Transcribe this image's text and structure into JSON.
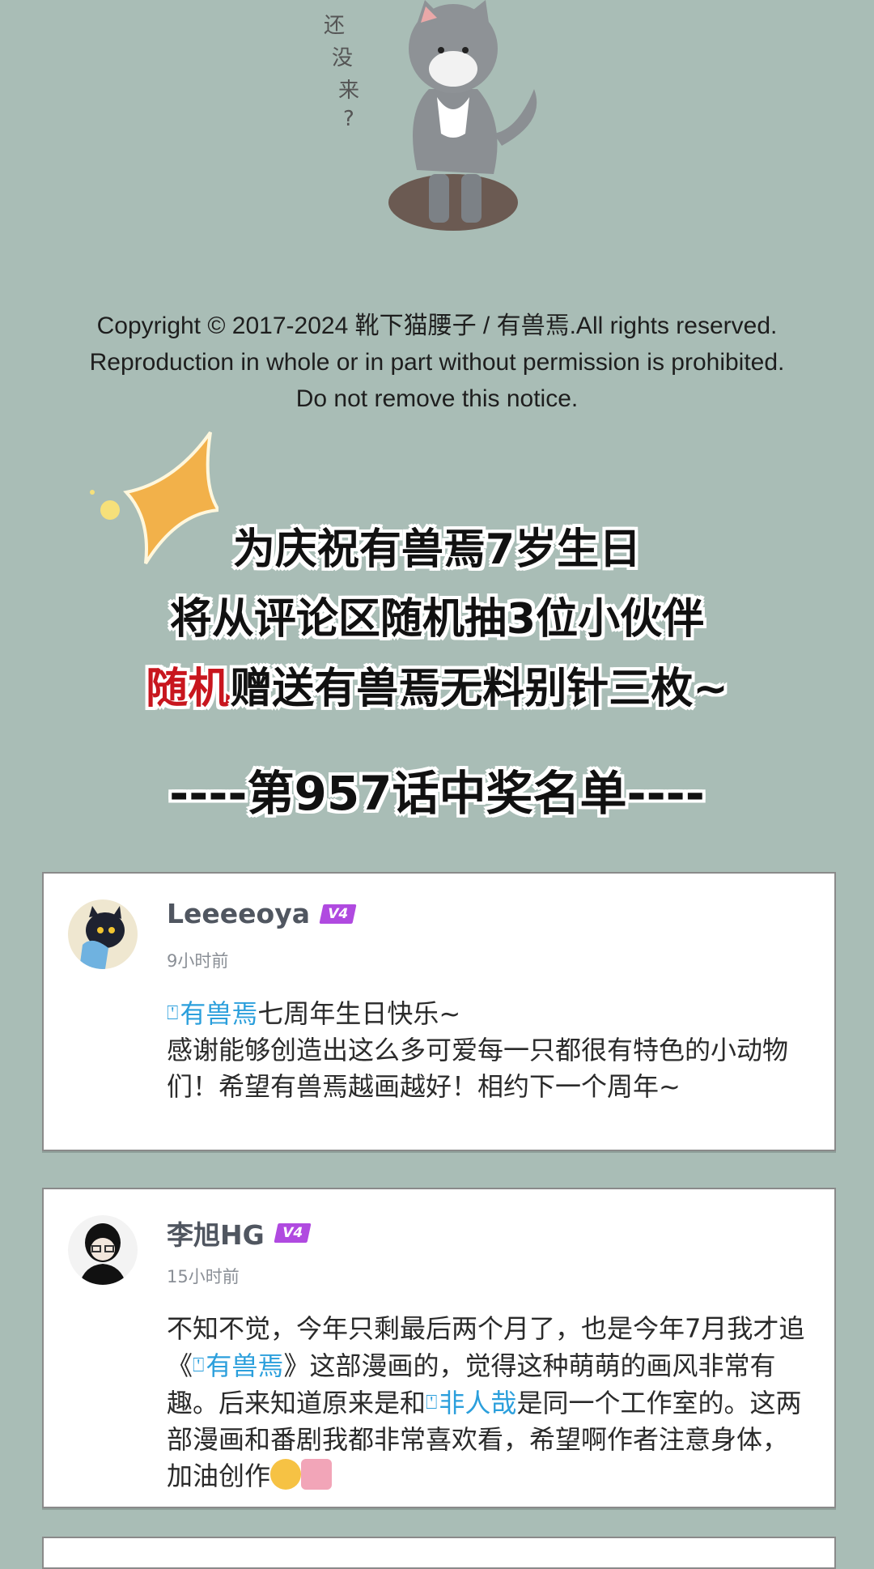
{
  "illustration": {
    "handwriting": [
      "还",
      "没",
      "来",
      "?"
    ]
  },
  "copyright": {
    "line1": "Copyright © 2017-2024 靴下猫腰子 / 有兽焉.All rights reserved.",
    "line2": "Reproduction in whole or in part without permission is prohibited.",
    "line3": "Do not remove this notice."
  },
  "banner": {
    "line1": "为庆祝有兽焉7岁生日",
    "line2": "将从评论区随机抽3位小伙伴",
    "line3_highlight": "随机",
    "line3_rest": "赠送有兽焉无料别针三枚~"
  },
  "winners_title": "----第957话中奖名单----",
  "comments": [
    {
      "username": "Leeeeoya",
      "badge": "V4",
      "time": "9小时前",
      "link_text": "有兽焉",
      "text_after_link": "七周年生日快乐~",
      "text_rest": "感谢能够创造出这么多可爱每一只都很有特色的小动物们！希望有兽焉越画越好！相约下一个周年~"
    },
    {
      "username": "李旭HG",
      "badge": "V4",
      "time": "15小时前",
      "text_a": "不知不觉，今年只剩最后两个月了，也是今年7月我才追《",
      "link1": "有兽焉",
      "text_b": "》这部漫画的，觉得这种萌萌的画风非常有趣。后来知道原来是和",
      "link2": "非人哉",
      "text_c": "是同一个工作室的。这两部漫画和番剧我都非常喜欢看，希望啊作者注意身体，加油创作"
    }
  ],
  "colors": {
    "background": "#a9bdb6",
    "link": "#2b9fdc",
    "highlight": "#c8161e",
    "badge": "#b04ae0"
  }
}
